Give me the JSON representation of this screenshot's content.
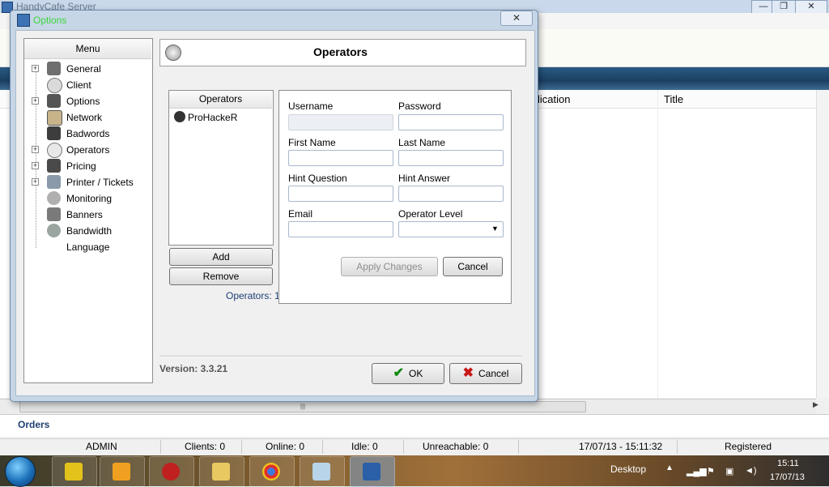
{
  "background_window": {
    "title": "HandyCafe Server",
    "window_buttons": [
      "—",
      "❐",
      "✕"
    ],
    "grid_columns": [
      "lication",
      "Title"
    ],
    "orders_tab": "Orders",
    "status_bar": {
      "user": "ADMIN",
      "clients": "Clients: 0",
      "online": "Online: 0",
      "idle": "Idle: 0",
      "unreachable": "Unreachable: 0",
      "datetime": "17/07/13 - 15:11:32",
      "registration": "Registered"
    }
  },
  "taskbar": {
    "desktop_label": "Desktop",
    "time": "15:11",
    "date": "17/07/13",
    "apps": [
      "pes-icon",
      "media-player-icon",
      "download-icon",
      "folder-icon",
      "chrome-icon",
      "notepad-icon",
      "handycafe-icon"
    ],
    "tray_icons": [
      "arrow-icon",
      "signal-icon",
      "flag-icon",
      "network-icon",
      "volume-icon"
    ]
  },
  "dialog": {
    "title": "Options",
    "close_glyph": "✕",
    "menu": {
      "header": "Menu",
      "items": [
        {
          "label": "General",
          "icon": "general-icon",
          "expandable": true
        },
        {
          "label": "Client",
          "icon": "client-icon",
          "expandable": false
        },
        {
          "label": "Options",
          "icon": "options-icon",
          "expandable": true
        },
        {
          "label": "Network",
          "icon": "network-icon",
          "expandable": false
        },
        {
          "label": "Badwords",
          "icon": "badwords-icon",
          "expandable": false
        },
        {
          "label": "Operators",
          "icon": "operators-icon",
          "expandable": true
        },
        {
          "label": "Pricing",
          "icon": "pricing-icon",
          "expandable": true
        },
        {
          "label": "Printer / Tickets",
          "icon": "printer-icon",
          "expandable": true
        },
        {
          "label": "Monitoring",
          "icon": "monitoring-icon",
          "expandable": false
        },
        {
          "label": "Banners",
          "icon": "banners-icon",
          "expandable": false
        },
        {
          "label": "Bandwidth",
          "icon": "bandwidth-icon",
          "expandable": false
        },
        {
          "label": "Language",
          "icon": "",
          "expandable": false
        }
      ]
    },
    "page": {
      "title": "Operators",
      "operators_list": {
        "header": "Operators",
        "items": [
          "ProHackeR"
        ],
        "add_label": "Add",
        "remove_label": "Remove",
        "count_label": "Operators: 1"
      },
      "form": {
        "username_label": "Username",
        "username_value": "",
        "password_label": "Password",
        "password_value": "",
        "first_name_label": "First Name",
        "first_name_value": "",
        "last_name_label": "Last Name",
        "last_name_value": "",
        "hint_question_label": "Hint Question",
        "hint_question_value": "",
        "hint_answer_label": "Hint Answer",
        "hint_answer_value": "",
        "email_label": "Email",
        "email_value": "",
        "operator_level_label": "Operator Level",
        "operator_level_value": "",
        "apply_label": "Apply Changes",
        "cancel_label": "Cancel"
      }
    },
    "version": "Version: 3.3.21",
    "ok_label": "OK",
    "cancel_label": "Cancel"
  }
}
